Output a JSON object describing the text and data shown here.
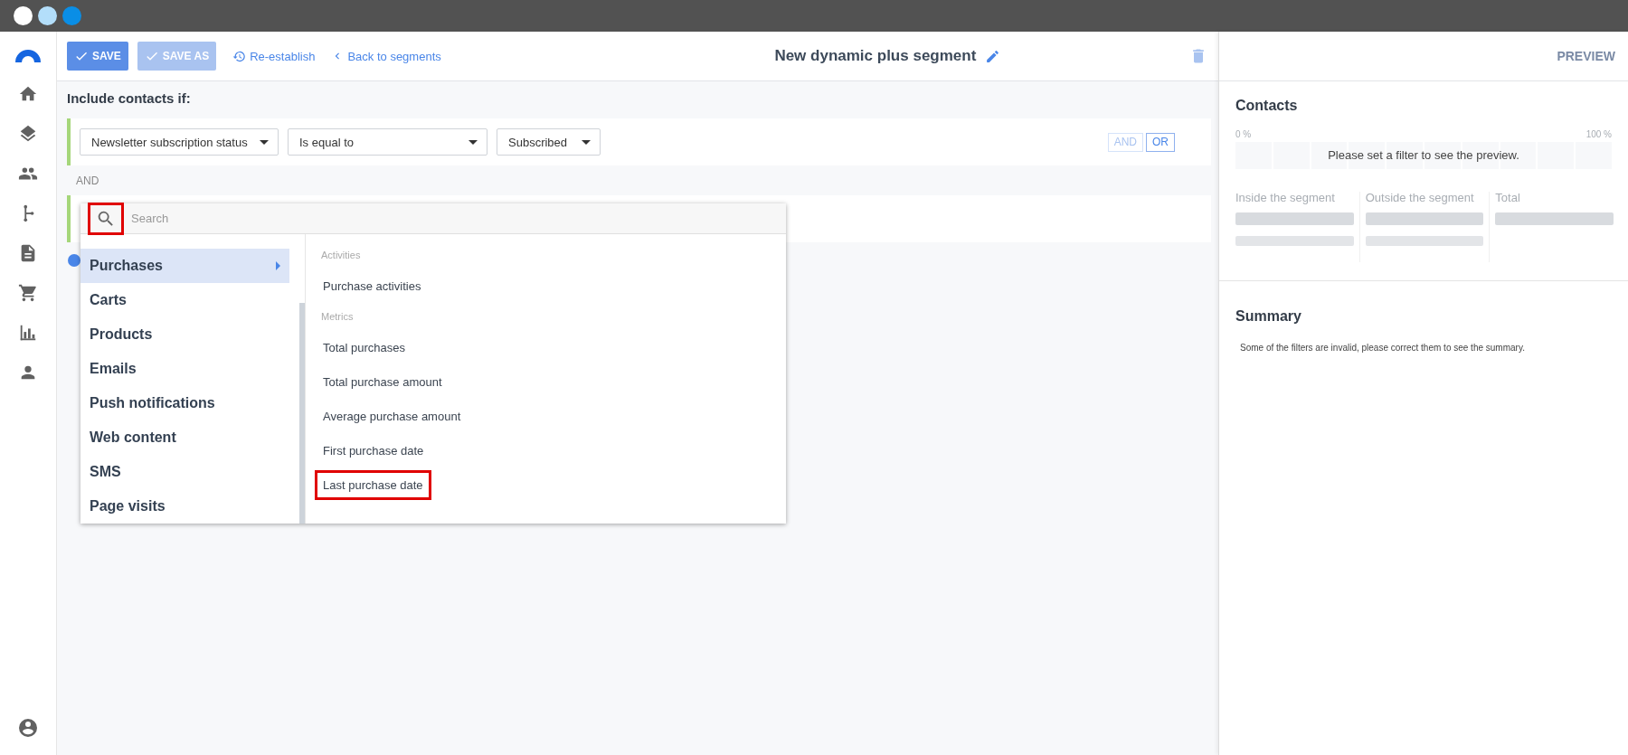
{
  "toolbar": {
    "buttons": [
      {
        "label": "SAVE",
        "disabled": false
      },
      {
        "label": "SAVE AS",
        "disabled": true
      }
    ],
    "links": [
      {
        "label": "Re-establish",
        "kind": "restore"
      },
      {
        "label": "Back to segments",
        "kind": "back"
      }
    ],
    "title": "New dynamic plus segment"
  },
  "editor": {
    "heading": "Include contacts if:",
    "filters": [
      {
        "value": "Newsletter subscription status"
      },
      {
        "value": "Is equal to"
      },
      {
        "value": "Subscribed"
      }
    ],
    "operators": [
      {
        "label": "AND",
        "selected": false
      },
      {
        "label": "OR",
        "selected": true
      }
    ],
    "connector": "AND"
  },
  "dropdown": {
    "search_placeholder": "Search",
    "search_highlighted": true,
    "categories": [
      {
        "label": "Purchases",
        "selected": true
      },
      {
        "label": "Carts",
        "selected": false
      },
      {
        "label": "Products",
        "selected": false
      },
      {
        "label": "Emails",
        "selected": false
      },
      {
        "label": "Push notifications",
        "selected": false
      },
      {
        "label": "Web content",
        "selected": false
      },
      {
        "label": "SMS",
        "selected": false
      },
      {
        "label": "Page visits",
        "selected": false
      }
    ],
    "sections": [
      {
        "heading": "Activities",
        "items": [
          {
            "label": "Purchase activities",
            "highlighted": false
          }
        ]
      },
      {
        "heading": "Metrics",
        "items": [
          {
            "label": "Total purchases",
            "highlighted": false
          },
          {
            "label": "Total purchase amount",
            "highlighted": false
          },
          {
            "label": "Average purchase amount",
            "highlighted": false
          },
          {
            "label": "First purchase date",
            "highlighted": false
          },
          {
            "label": "Last purchase date",
            "highlighted": true
          }
        ]
      }
    ]
  },
  "preview": {
    "title": "PREVIEW",
    "contacts": {
      "heading": "Contacts",
      "scale_start": "0 %",
      "scale_end": "100 %",
      "message": "Please set a filter to see the preview.",
      "stats": [
        {
          "label": "Inside the segment",
          "secondary_line": true
        },
        {
          "label": "Outside the segment",
          "secondary_line": true
        },
        {
          "label": "Total",
          "secondary_line": false
        }
      ]
    },
    "summary": {
      "heading": "Summary",
      "message": "Some of the filters are invalid, please correct them to see the summary."
    }
  }
}
